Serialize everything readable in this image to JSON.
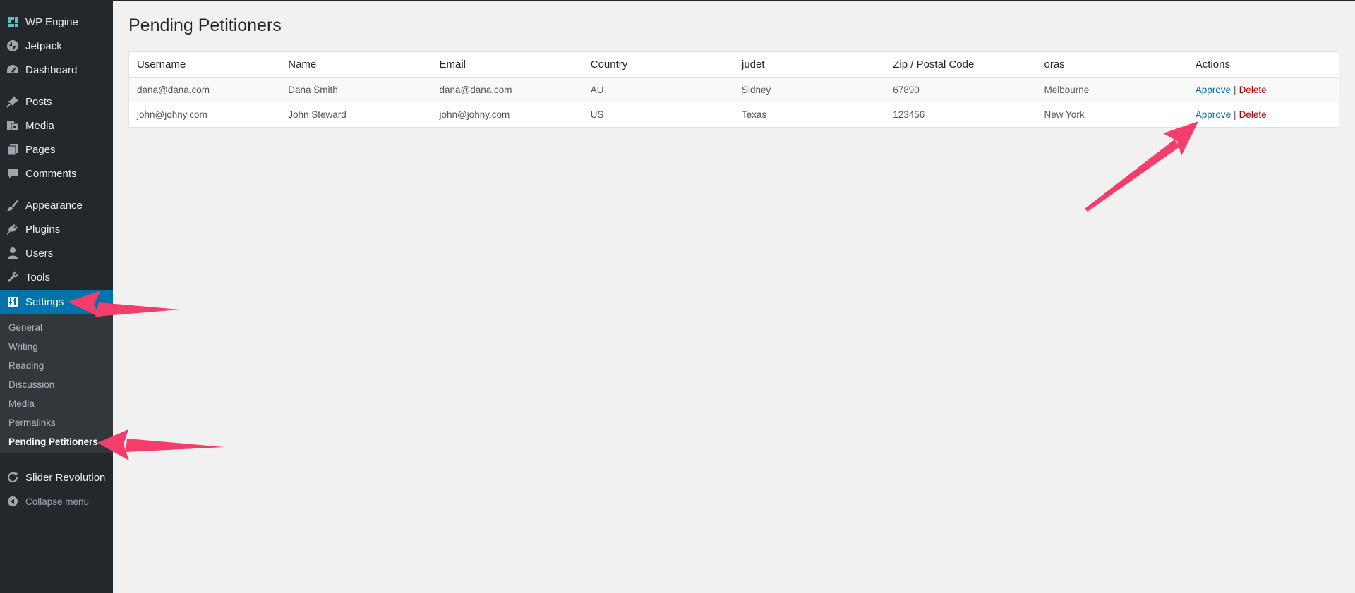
{
  "sidebar": {
    "items": [
      {
        "label": "WP Engine",
        "icon": "wp-engine-icon"
      },
      {
        "label": "Jetpack",
        "icon": "jetpack-icon"
      },
      {
        "label": "Dashboard",
        "icon": "dashboard-icon"
      },
      {
        "label": "Posts",
        "icon": "pin-icon"
      },
      {
        "label": "Media",
        "icon": "media-icon"
      },
      {
        "label": "Pages",
        "icon": "pages-icon"
      },
      {
        "label": "Comments",
        "icon": "comments-icon"
      },
      {
        "label": "Appearance",
        "icon": "brush-icon"
      },
      {
        "label": "Plugins",
        "icon": "plugin-icon"
      },
      {
        "label": "Users",
        "icon": "users-icon"
      },
      {
        "label": "Tools",
        "icon": "wrench-icon"
      },
      {
        "label": "Settings",
        "icon": "settings-icon"
      }
    ],
    "settings_submenu": [
      "General",
      "Writing",
      "Reading",
      "Discussion",
      "Media",
      "Permalinks",
      "Pending Petitioners"
    ],
    "slider_revolution": "Slider Revolution",
    "collapse_label": "Collapse menu",
    "active_color": "#0073aa"
  },
  "page": {
    "title": "Pending Petitioners"
  },
  "table": {
    "headers": [
      "Username",
      "Name",
      "Email",
      "Country",
      "judet",
      "Zip / Postal Code",
      "oras",
      "Actions"
    ],
    "rows": [
      {
        "username": "dana@dana.com",
        "name": "Dana Smith",
        "email": "dana@dana.com",
        "country": "AU",
        "judet": "Sidney",
        "zip": "67890",
        "oras": "Melbourne",
        "approve": "Approve",
        "separator": "|",
        "delete": "Delete"
      },
      {
        "username": "john@johny.com",
        "name": "John Steward",
        "email": "john@johny.com",
        "country": "US",
        "judet": "Texas",
        "zip": "123456",
        "oras": "New York",
        "approve": "Approve",
        "separator": "|",
        "delete": "Delete"
      }
    ]
  },
  "annotation_color": "#f53d6b"
}
